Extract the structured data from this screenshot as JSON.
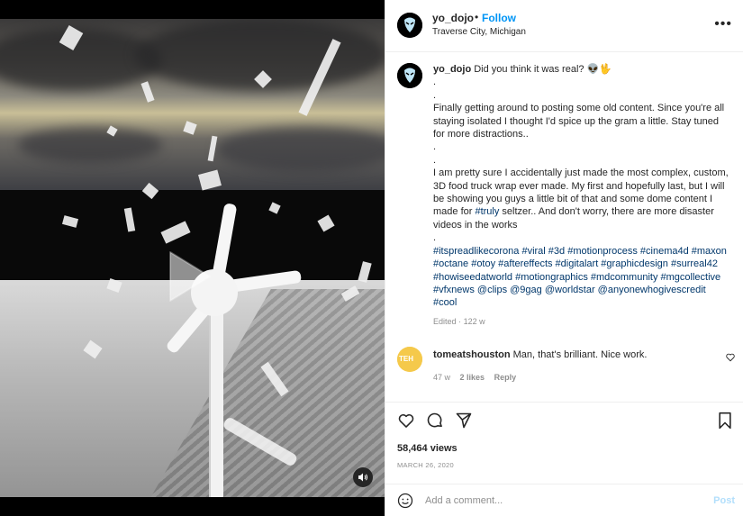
{
  "header": {
    "username": "yo_dojo",
    "separator": "•",
    "follow_label": "Follow",
    "location": "Traverse City, Michigan",
    "more_icon": "more-horizontal-icon"
  },
  "caption": {
    "username": "yo_dojo",
    "first_line": "Did you think it was real? 👽🖖",
    "dot1": ".",
    "dot2": ".",
    "para1": "Finally getting around to posting some old content. Since you're all staying isolated I thought I'd spice up the gram a little. Stay tuned for more distractions..",
    "dot3": ".",
    "dot4": ".",
    "para2_a": "I am pretty sure I accidentally just made the most complex, custom, 3D food truck wrap ever made. My first and hopefully last, but I will be showing you guys a little bit of that and some dome content I made for ",
    "para2_tag": "#truly",
    "para2_b": " seltzer.. And don't worry, there are more disaster videos in the works",
    "dot5": ".",
    "hashtags": "#itspreadlikecorona #viral #3d #motionprocess #cinema4d #maxon #octane #otoy #aftereffects #digitalart #graphicdesign #surreal42 #howiseedatworld #motiongraphics #mdcommunity #mgcollective #vfxnews @clips @9gag @worldstar @anyonewhogivescredit #cool",
    "edited": "Edited",
    "separator": "·",
    "time": "122 w"
  },
  "comment": {
    "avatar_text": "TEH",
    "username": "tomeatshouston",
    "text": "Man, that's brilliant. Nice work.",
    "time": "47 w",
    "likes": "2 likes",
    "reply_label": "Reply"
  },
  "actions": {
    "icons": [
      "heart-icon",
      "comment-icon",
      "share-icon",
      "bookmark-icon"
    ],
    "views": "58,464 views",
    "date": "MARCH 26, 2020"
  },
  "add_comment": {
    "placeholder": "Add a comment...",
    "post_label": "Post",
    "emoji_icon": "emoji-icon"
  },
  "colors": {
    "link_blue": "#0095f6",
    "hashtag": "#00376b",
    "muted": "#8e8e8e",
    "post_disabled": "#b2dffc"
  }
}
